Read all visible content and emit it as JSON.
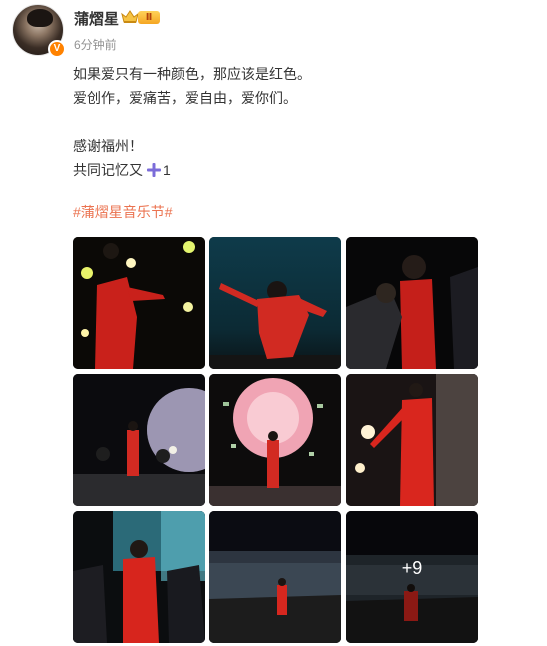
{
  "user": {
    "name": "蒲熠星",
    "level": "Ⅱ",
    "verified_mark": "V",
    "time": "6分钟前"
  },
  "content": {
    "lines": [
      "如果爱只有一种颜色，那应该是红色。",
      "爱创作，爱痛苦，爱自由，爱你们。",
      "",
      "感谢福州！"
    ],
    "last_line_prefix": "共同记忆又",
    "last_line_suffix": "1",
    "hashtag": "#蒲熠星音乐节#"
  },
  "photos": {
    "items": [
      "photo-1-singer-red-suit-stage-lights",
      "photo-2-singer-pointing-teal-backdrop",
      "photo-3-singer-with-crowd-dark",
      "photo-4-band-on-stage-moon-screen",
      "photo-5-confetti-pink-smoke",
      "photo-6-singer-bright-lights",
      "photo-7-singer-with-band-graffiti-screen",
      "photo-8-stage-wide-audience",
      "photo-9-kneeling-audience"
    ],
    "more_count": "+9"
  },
  "colors": {
    "hashtag": "#eb7350",
    "accent_red": "#d8261f",
    "verified": "#ff8200"
  }
}
